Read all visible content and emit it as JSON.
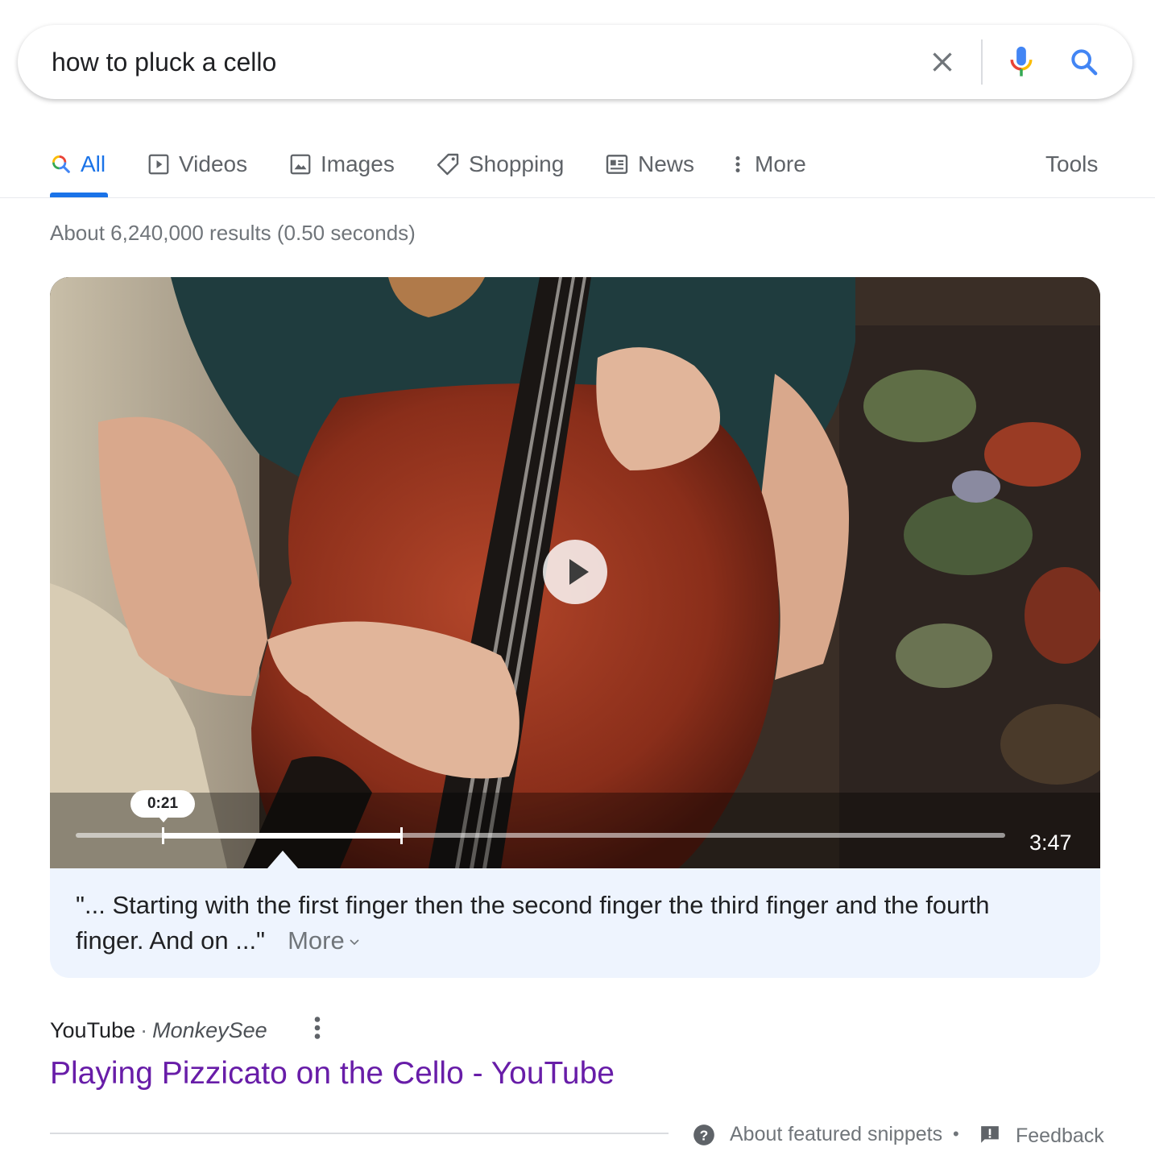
{
  "search": {
    "query": "how to pluck a cello"
  },
  "tabs": [
    {
      "label": "All",
      "icon": "search-icon",
      "active": true
    },
    {
      "label": "Videos",
      "icon": "video-icon"
    },
    {
      "label": "Images",
      "icon": "image-icon"
    },
    {
      "label": "Shopping",
      "icon": "tag-icon"
    },
    {
      "label": "News",
      "icon": "news-icon"
    },
    {
      "label": "More",
      "icon": "more-vert-icon"
    }
  ],
  "tools_label": "Tools",
  "result_stats": "About 6,240,000 results (0.50 seconds)",
  "video": {
    "current_time": "0:21",
    "duration": "3:47",
    "snippet": "\"... Starting with the first finger then the second finger the third finger and the fourth finger. And on ...\"",
    "more_label": "More"
  },
  "result": {
    "source": "YouTube",
    "author": "MonkeySee",
    "title": "Playing Pizzicato on the Cello - YouTube"
  },
  "footer": {
    "about": "About featured snippets",
    "bullet": "•",
    "feedback": "Feedback"
  },
  "colors": {
    "accent": "#1a73e8",
    "visited_link": "#681da8",
    "snippet_bg": "#eef4fe"
  }
}
